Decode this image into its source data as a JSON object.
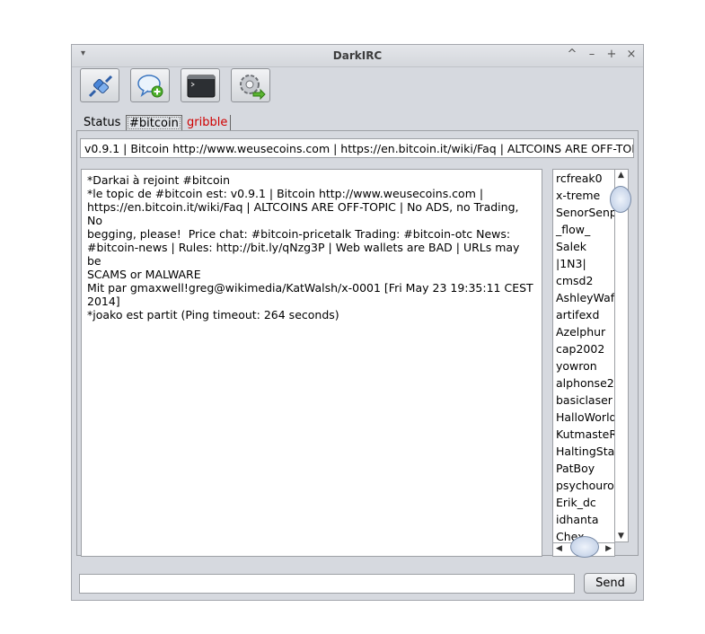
{
  "window": {
    "title": "DarkIRC",
    "controls": [
      "^",
      "–",
      "+",
      "×"
    ],
    "menu_icon": "▾"
  },
  "toolbar": {
    "buttons": [
      {
        "icon": "connect-plug-icon"
      },
      {
        "icon": "new-chat-icon"
      },
      {
        "icon": "terminal-icon"
      },
      {
        "icon": "settings-gear-icon"
      }
    ]
  },
  "tabs": [
    {
      "label": "Status"
    },
    {
      "label": "#bitcoin"
    },
    {
      "label": "gribble",
      "color": "#d00000"
    }
  ],
  "topic": "v0.9.1 | Bitcoin http://www.weusecoins.com | https://en.bitcoin.it/wiki/Faq | ALTCOINS ARE OFF-TOPI",
  "chat": {
    "lines": [
      "*Darkai à rejoint #bitcoin",
      "*le topic de #bitcoin est: v0.9.1 | Bitcoin http://www.weusecoins.com |\nhttps://en.bitcoin.it/wiki/Faq | ALTCOINS ARE OFF-TOPIC | No ADS, no Trading, No\nbegging, please!  Price chat: #bitcoin-pricetalk Trading: #bitcoin-otc News:\n#bitcoin-news | Rules: http://bit.ly/qNzg3P | Web wallets are BAD | URLs may be\nSCAMS or MALWARE",
      "Mit par gmaxwell!greg@wikimedia/KatWalsh/x-0001 [Fri May 23 19:35:11 CEST\n2014]",
      "*joako est partit (Ping timeout: 264 seconds)"
    ]
  },
  "users": [
    "rcfreak0",
    "x-treme",
    "SenorSenp",
    "_flow_",
    "Salek",
    "|1N3|",
    "cmsd2",
    "AshleyWaff",
    "artifexd",
    "Azelphur",
    "cap2002",
    "yowron",
    "alphonse2",
    "basiclaser",
    "HalloWorld",
    "KutmasteR",
    "HaltingStat",
    "PatBoy",
    "psychouro",
    "Erik_dc",
    "idhanta",
    "Chex"
  ],
  "message_input": {
    "value": ""
  },
  "send_label": "Send",
  "scroll": {
    "up": "▲",
    "down": "▼",
    "left": "◀",
    "right": "▶"
  }
}
